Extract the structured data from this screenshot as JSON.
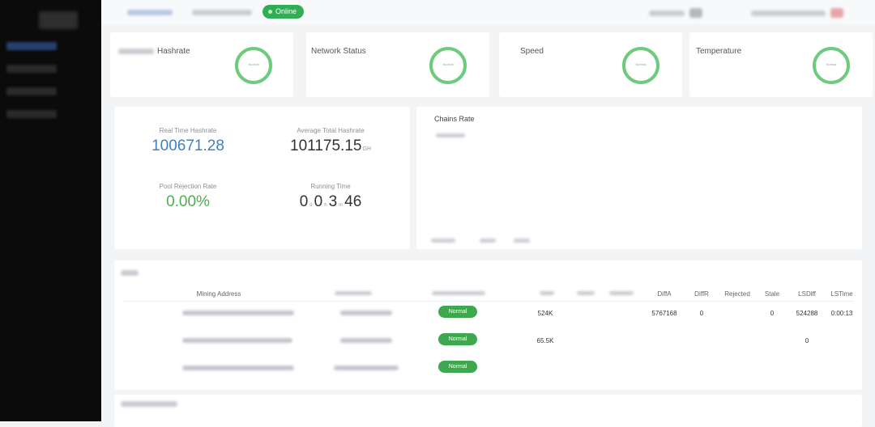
{
  "header": {
    "status": "Online"
  },
  "stats": [
    {
      "title": "Hashrate",
      "ring_label": "Normal"
    },
    {
      "title": "Network Status",
      "ring_label": "Normal"
    },
    {
      "title": "Speed",
      "ring_label": "Normal"
    },
    {
      "title": "Temperature",
      "ring_label": "Normal"
    }
  ],
  "metrics": {
    "realtime": {
      "label": "Real Time Hashrate",
      "value": "100671.28"
    },
    "average": {
      "label": "Average Total Hashrate",
      "value": "101175.15",
      "unit": "GH"
    },
    "rejection": {
      "label": "Pool Rejection Rate",
      "value": "0.00%"
    },
    "running": {
      "label": "Running Time",
      "d": "0",
      "h": "0",
      "m": "3",
      "s": "46",
      "d_unit": "d",
      "h_unit": "h",
      "m_unit": "m"
    }
  },
  "chart": {
    "title": "Chains Rate"
  },
  "table": {
    "headers": {
      "address": "Mining Address",
      "diffa": "DiffA",
      "diffr": "DiffR",
      "rejected": "Rejected",
      "stale": "Stale",
      "lsdiff": "LSDiff",
      "lstime": "LSTime"
    },
    "rows": [
      {
        "state": "Normal",
        "diff": "524K",
        "diffa": "5767168",
        "diffr": "0",
        "stale": "0",
        "lsdiff": "524288",
        "lstime": "0:00:13"
      },
      {
        "state": "Normal",
        "diff": "65.5K",
        "diffa": "",
        "diffr": "",
        "stale": "",
        "lsdiff": "0",
        "lstime": ""
      },
      {
        "state": "Normal",
        "diff": "",
        "diffa": "",
        "diffr": "",
        "stale": "",
        "lsdiff": "",
        "lstime": ""
      }
    ]
  }
}
